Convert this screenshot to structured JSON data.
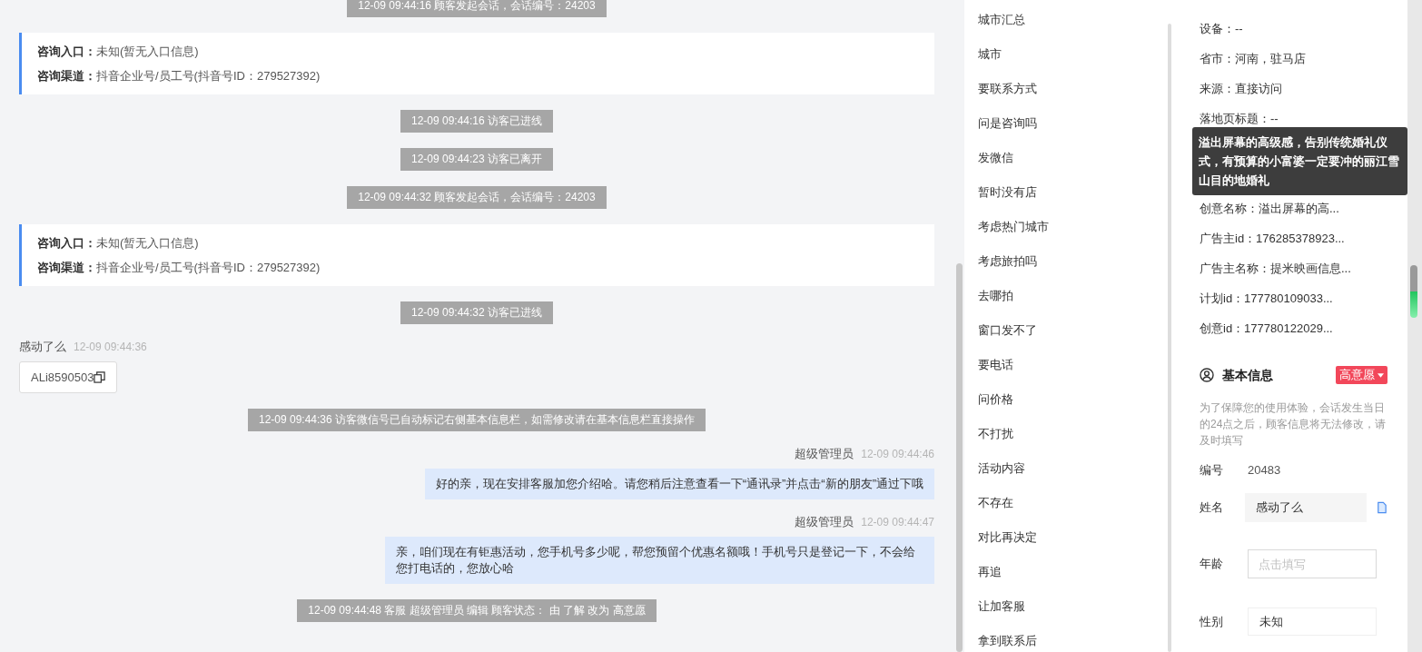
{
  "chat": {
    "events": [
      {
        "kind": "system",
        "text": "12-09 09:44:16 顾客发起会话，会话编号：24203"
      },
      {
        "kind": "entry_card",
        "rows": [
          {
            "label": "咨询入口：",
            "value": "未知(暂无入口信息)"
          },
          {
            "label": "咨询渠道：",
            "value": "抖音企业号/员工号(抖音号ID：279527392)"
          }
        ]
      },
      {
        "kind": "system",
        "text": "12-09 09:44:16 访客已进线"
      },
      {
        "kind": "system",
        "text": "12-09 09:44:23 访客已离开"
      },
      {
        "kind": "system",
        "text": "12-09 09:44:32 顾客发起会话，会话编号：24203"
      },
      {
        "kind": "entry_card",
        "rows": [
          {
            "label": "咨询入口：",
            "value": "未知(暂无入口信息)"
          },
          {
            "label": "咨询渠道：",
            "value": "抖音企业号/员工号(抖音号ID：279527392)"
          }
        ]
      },
      {
        "kind": "system",
        "text": "12-09 09:44:32 访客已进线"
      },
      {
        "kind": "visitor_message",
        "sender": "感动了么",
        "time": "12-09 09:44:36",
        "text": "ALi8590503"
      },
      {
        "kind": "system",
        "text": "12-09 09:44:36 访客微信号已自动标记右侧基本信息栏，如需修改请在基本信息栏直接操作"
      },
      {
        "kind": "agent_message",
        "sender": "超级管理员",
        "time": "12-09 09:44:46",
        "text": "好的亲，现在安排客服加您介绍哈。请您稍后注意查看一下“通讯录”并点击“新的朋友”通过下哦"
      },
      {
        "kind": "agent_message",
        "sender": "超级管理员",
        "time": "12-09 09:44:47",
        "text": "亲，咱们现在有钜惠活动，您手机号多少呢，帮您预留个优惠名额哦！手机号只是登记一下，不会给您打电话的，您放心哈"
      },
      {
        "kind": "system",
        "text": "12-09 09:44:48 客服 超级管理员 编辑 顾客状态： 由 了解 改为 高意愿"
      }
    ]
  },
  "quick_replies": {
    "items": [
      "城市汇总",
      "城市",
      "要联系方式",
      "问是咨询吗",
      "发微信",
      "暂时没有店",
      "考虑热门城市",
      "考虑旅拍吗",
      "去哪拍",
      "窗口发不了",
      "要电话",
      "问价格",
      "不打扰",
      "活动内容",
      "不存在",
      "对比再决定",
      "再追",
      "让加客服",
      "拿到联系后"
    ]
  },
  "visitor_info": {
    "rows": [
      {
        "text": "设备：--"
      },
      {
        "text": "省市：河南，驻马店"
      },
      {
        "text": "来源：直接访问"
      },
      {
        "text": "落地页标题：--"
      },
      {
        "text": "创意名称：溢出屏幕的高..."
      },
      {
        "text": "广告主id：176285378923..."
      },
      {
        "text": "广告主名称：提米映画信息..."
      },
      {
        "text": "计划id：177780109033..."
      },
      {
        "text": "创意id：177780122029..."
      }
    ],
    "tooltip": "溢出屏幕的高级感，告别传统婚礼仪式，有预算的小富婆一定要冲的丽江雪山目的地婚礼"
  },
  "basic_info": {
    "title": "基本信息",
    "intent_tag": "高意愿",
    "notice": "为了保障您的使用体验，会话发生当日的24点之后，顾客信息将无法修改，请及时填写",
    "fields": [
      {
        "kind": "text",
        "label": "编号",
        "value": "20483"
      },
      {
        "kind": "filled",
        "label": "姓名",
        "value": "感动了么"
      },
      {
        "kind": "input",
        "label": "年龄",
        "placeholder": "点击填写"
      },
      {
        "kind": "select",
        "label": "性别",
        "value": "未知"
      }
    ]
  }
}
